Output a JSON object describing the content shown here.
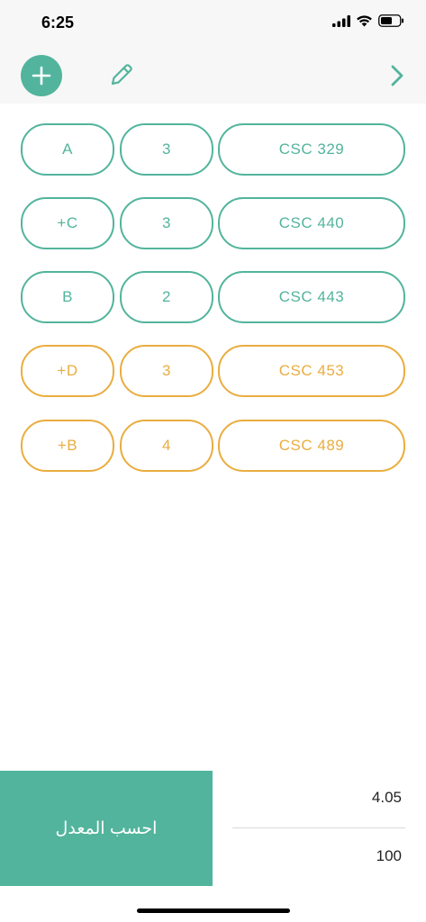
{
  "status_bar": {
    "time": "6:25"
  },
  "toolbar": {
    "add_icon": "plus-icon",
    "edit_icon": "pencil-icon",
    "next_icon": "chevron-right-icon"
  },
  "colors": {
    "accent": "#52b49c",
    "warning": "#eaad3f"
  },
  "courses": [
    {
      "grade": "A",
      "credits": "3",
      "course": "CSC 329",
      "color": "#52b49c"
    },
    {
      "grade": "+C",
      "credits": "3",
      "course": "CSC 440",
      "color": "#52b49c"
    },
    {
      "grade": "B",
      "credits": "2",
      "course": "CSC 443",
      "color": "#52b49c"
    },
    {
      "grade": "+D",
      "credits": "3",
      "course": "CSC 453",
      "color": "#eaad3f"
    },
    {
      "grade": "+B",
      "credits": "4",
      "course": "CSC 489",
      "color": "#eaad3f"
    }
  ],
  "footer": {
    "calculate_label": "احسب المعدل",
    "gpa": "4.05",
    "total": "100"
  }
}
